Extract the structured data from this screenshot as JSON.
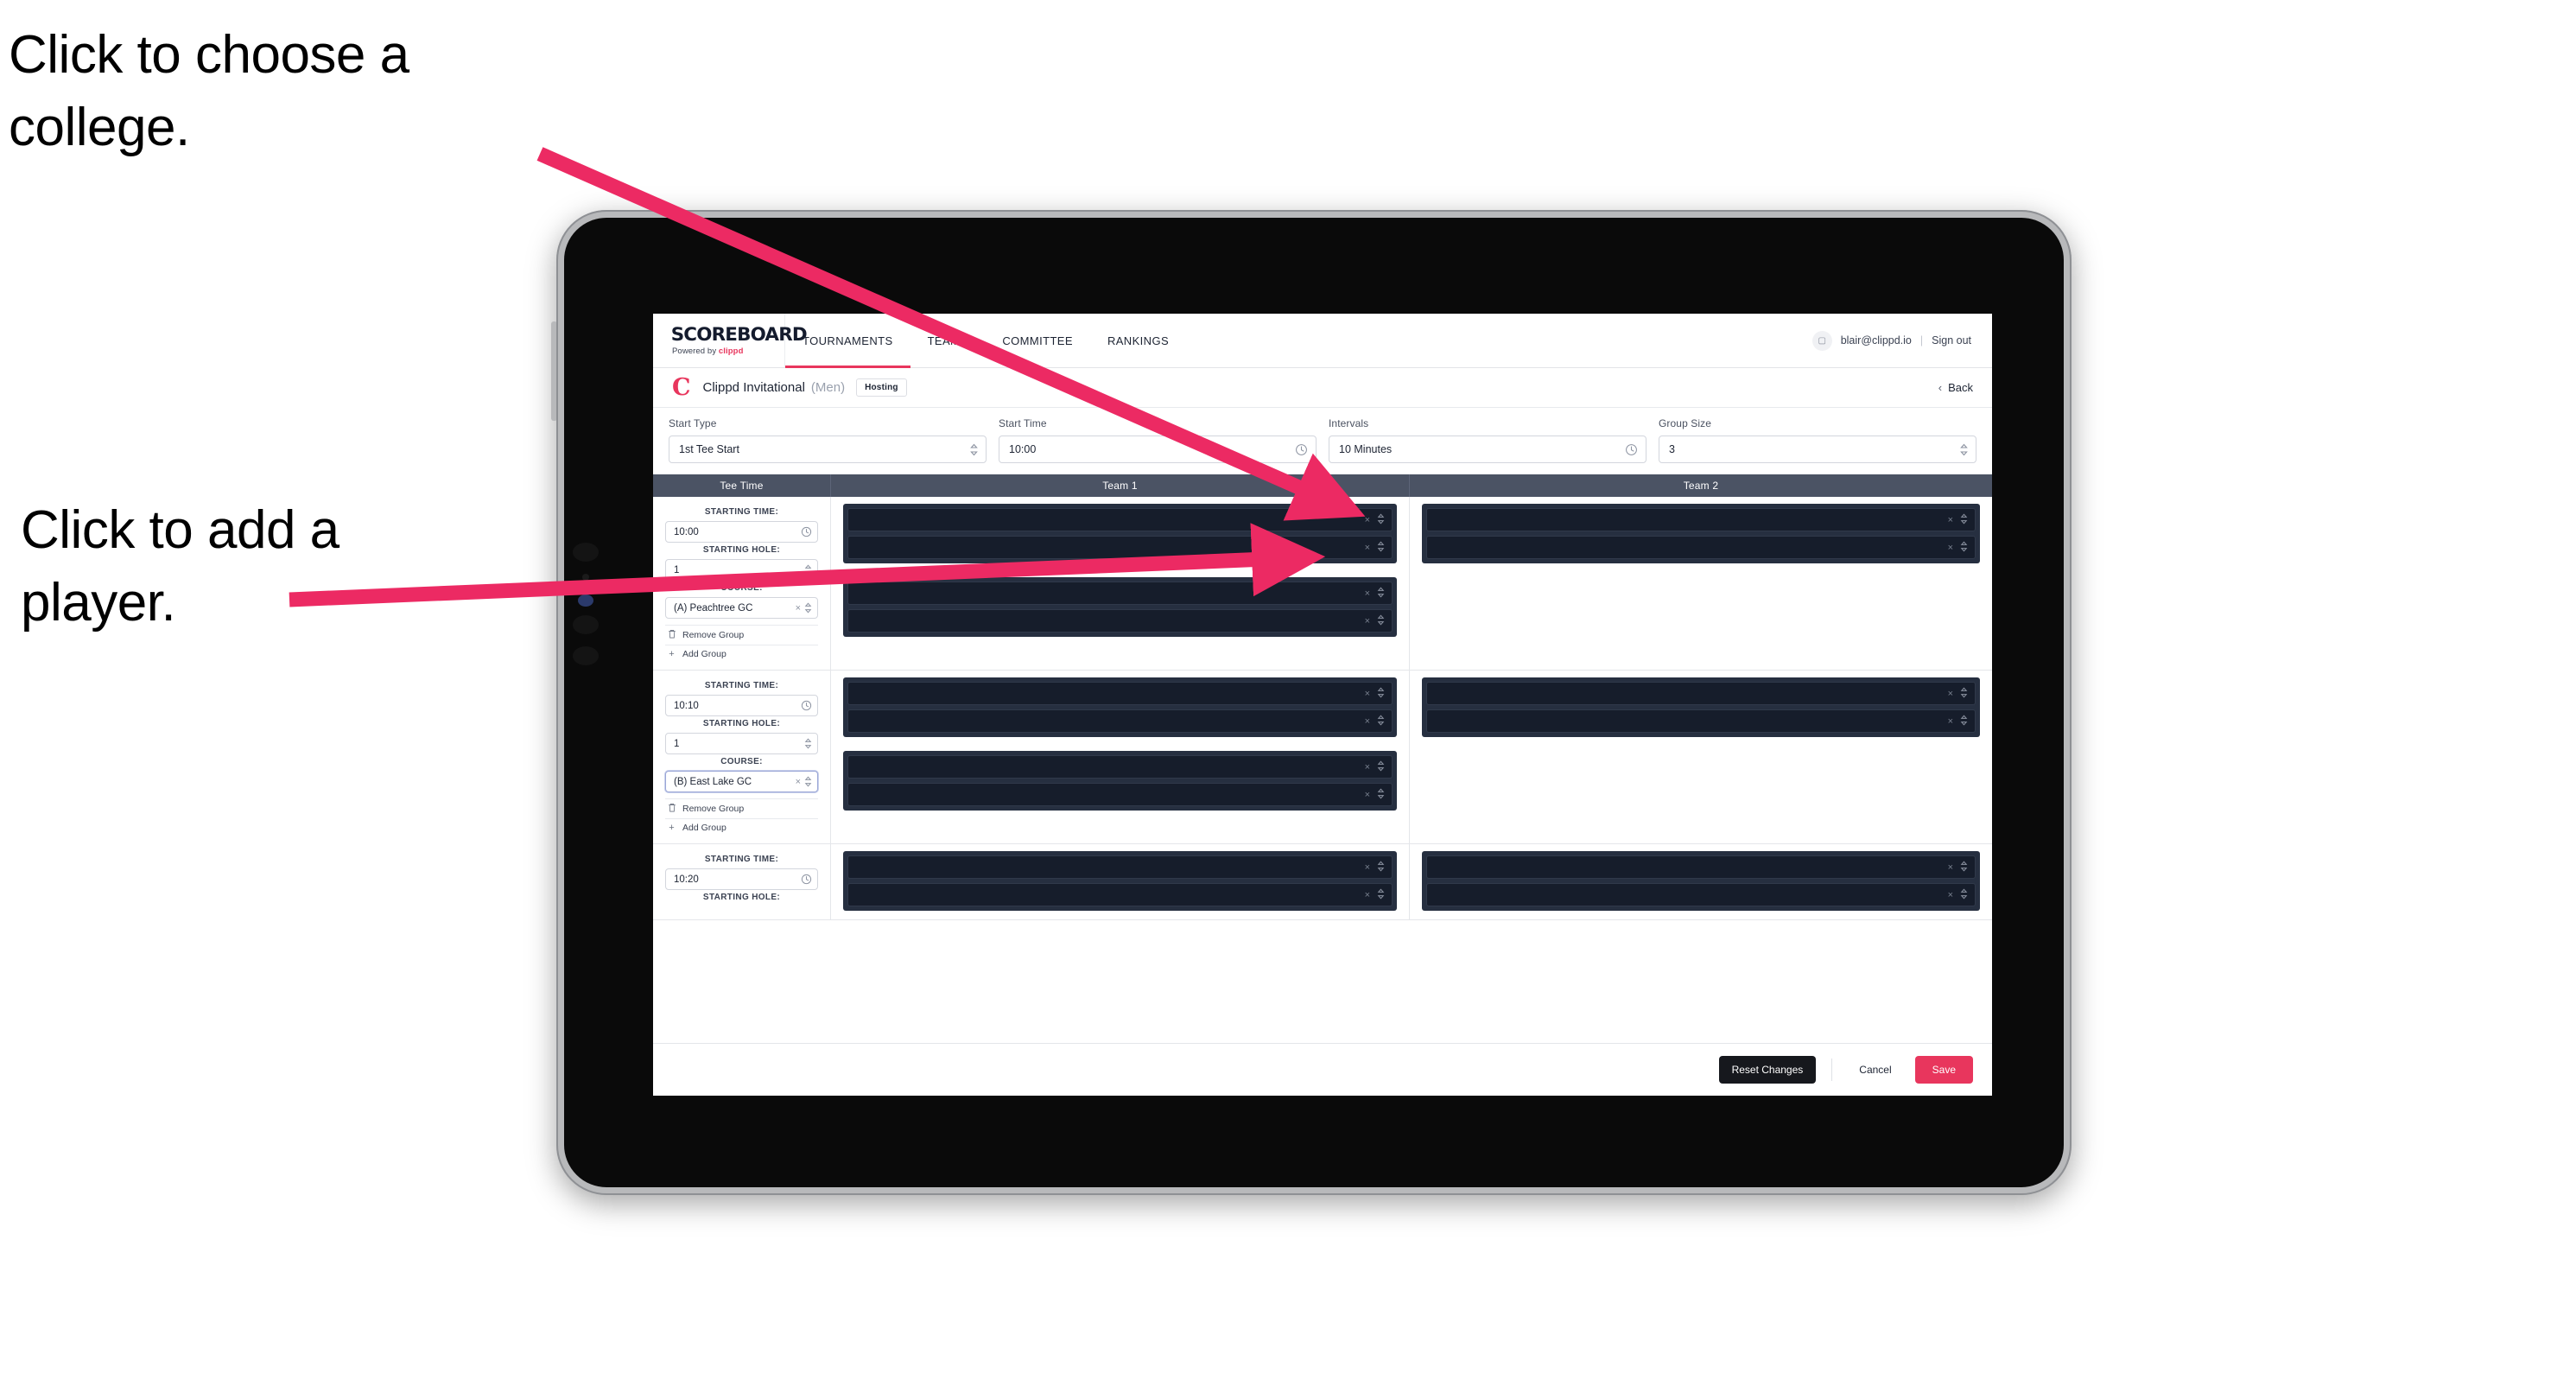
{
  "annotations": [
    {
      "id": "college",
      "text": "Click to choose a college."
    },
    {
      "id": "player",
      "text": "Click to add a player."
    }
  ],
  "accent_color": "#e8365d",
  "header_bar_color": "#4b5364",
  "nav": {
    "brand": {
      "title": "SCOREBOARD",
      "sub_prefix": "Powered by ",
      "sub_brand": "clippd"
    },
    "items": [
      {
        "label": "TOURNAMENTS",
        "active": true
      },
      {
        "label": "TEAMS",
        "active": false
      },
      {
        "label": "COMMITTEE",
        "active": false
      },
      {
        "label": "RANKINGS",
        "active": false
      }
    ],
    "account": {
      "avatar_icon": "user-badge-icon",
      "email": "blair@clippd.io",
      "separator": "|",
      "signout": "Sign out"
    }
  },
  "tournament": {
    "logo_letter": "C",
    "name": "Clippd Invitational",
    "gender": "(Men)",
    "badge": "Hosting",
    "back_label": "Back",
    "back_chevron": "‹"
  },
  "controls": [
    {
      "label": "Start Type",
      "value": "1st Tee Start",
      "icon": "stepper-icon",
      "glyph": "⌃⌄"
    },
    {
      "label": "Start Time",
      "value": "10:00",
      "icon": "clock-icon",
      "glyph": "○"
    },
    {
      "label": "Intervals",
      "value": "10 Minutes",
      "icon": "clock-icon",
      "glyph": "○"
    },
    {
      "label": "Group Size",
      "value": "3",
      "icon": "stepper-icon",
      "glyph": "⌃⌄"
    }
  ],
  "table": {
    "columns": [
      {
        "key": "teetime",
        "label": "Tee Time"
      },
      {
        "key": "team1",
        "label": "Team 1"
      },
      {
        "key": "team2",
        "label": "Team 2"
      }
    ],
    "field_labels": {
      "starting_time": "STARTING TIME:",
      "starting_hole": "STARTING HOLE:",
      "course": "COURSE:"
    },
    "group_actions": {
      "remove": "Remove Group",
      "remove_icon": "trash-icon",
      "add": "Add Group",
      "add_icon": "plus-icon"
    },
    "player_row_icons": {
      "clear": "×",
      "clear_name": "clear-icon",
      "stepper": "⌃⌄",
      "stepper_name": "stepper-icon"
    },
    "rows": [
      {
        "starting_time": "10:00",
        "starting_hole": "1",
        "course": "(A) Peachtree GC",
        "course_focused": false,
        "team1_groups": [
          {
            "players": 2
          },
          {
            "players": 2
          }
        ],
        "team2_groups": [
          {
            "players": 2
          }
        ]
      },
      {
        "starting_time": "10:10",
        "starting_hole": "1",
        "course": "(B) East Lake GC",
        "course_focused": true,
        "team1_groups": [
          {
            "players": 2
          },
          {
            "players": 2
          }
        ],
        "team2_groups": [
          {
            "players": 2
          }
        ]
      },
      {
        "starting_time": "10:20",
        "starting_hole": "",
        "course": "",
        "course_focused": false,
        "team1_groups": [
          {
            "players": 2
          }
        ],
        "team2_groups": [
          {
            "players": 2
          }
        ],
        "clipped": true
      }
    ]
  },
  "footer": {
    "reset": "Reset Changes",
    "cancel": "Cancel",
    "save": "Save"
  }
}
